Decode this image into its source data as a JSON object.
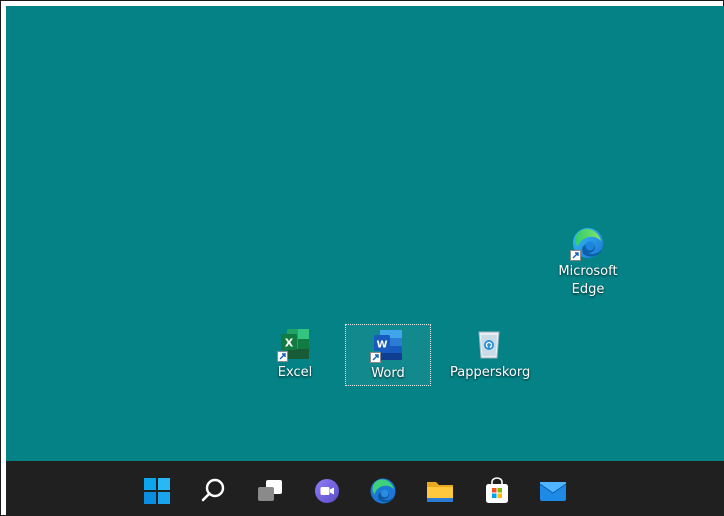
{
  "desktop": {
    "background": "#048286",
    "icons": [
      {
        "label": "Microsoft Edge",
        "icon": "edge-icon"
      },
      {
        "label": "Excel",
        "icon": "excel-icon"
      },
      {
        "label": "Word",
        "icon": "word-icon",
        "selected": true
      },
      {
        "label": "Papperskorg",
        "icon": "recycle-bin-icon"
      }
    ]
  },
  "taskbar": {
    "background": "#202020",
    "items": [
      {
        "icon": "start-icon"
      },
      {
        "icon": "search-icon"
      },
      {
        "icon": "task-view-icon"
      },
      {
        "icon": "chat-icon"
      },
      {
        "icon": "edge-icon"
      },
      {
        "icon": "file-explorer-icon"
      },
      {
        "icon": "store-icon"
      },
      {
        "icon": "mail-icon"
      }
    ]
  }
}
